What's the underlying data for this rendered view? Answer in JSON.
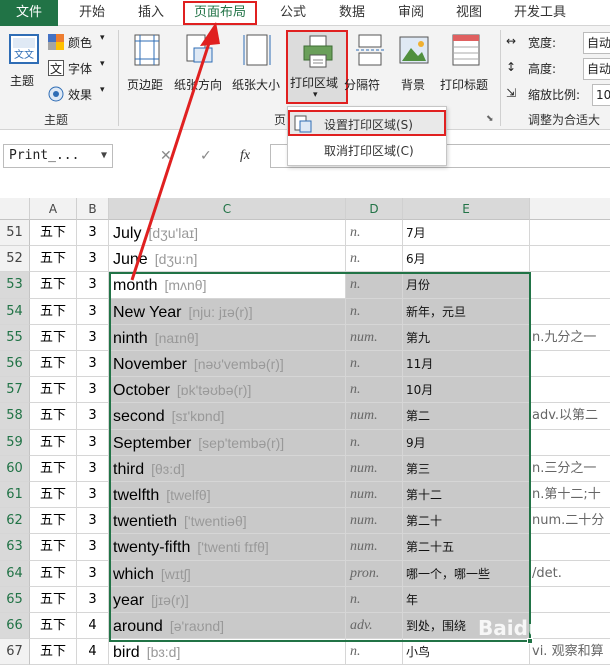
{
  "tabs": [
    {
      "label": "文件",
      "type": "file"
    },
    {
      "label": "开始"
    },
    {
      "label": "插入"
    },
    {
      "label": "页面布局",
      "active": true
    },
    {
      "label": "公式"
    },
    {
      "label": "数据"
    },
    {
      "label": "审阅"
    },
    {
      "label": "视图"
    },
    {
      "label": "开发工具"
    }
  ],
  "ribbon": {
    "theme_group": {
      "name": "主题",
      "theme_btn": "主题",
      "colors": "颜色",
      "fonts": "字体",
      "effects": "效果",
      "theme_icon_text": "文文"
    },
    "page_setup": {
      "margins": "页边距",
      "orientation": "纸张方向",
      "size": "纸张大小",
      "print_area": "打印区域",
      "breaks": "分隔符",
      "background": "背景",
      "print_titles": "打印标题",
      "group_name": "页"
    },
    "scale_group": {
      "width_label": "宽度:",
      "width_value": "自动",
      "height_label": "高度:",
      "height_value": "自动",
      "scale_label": "缩放比例:",
      "scale_value": "10",
      "group_name": "调整为合适大小"
    }
  },
  "print_area_menu": {
    "set": "设置打印区域(S)",
    "clear": "取消打印区域(C)"
  },
  "formula_bar": {
    "name_box": "Print_...",
    "cancel": "✕",
    "enter": "✓",
    "fx": "fx",
    "content": ""
  },
  "columns": [
    "A",
    "B",
    "C",
    "D",
    "E"
  ],
  "rows": [
    {
      "num": "51",
      "a": "五下",
      "b": "3",
      "word": "July",
      "phon": "[dʒu'laɪ]",
      "pos": "n.",
      "cn": "7月",
      "extra": ""
    },
    {
      "num": "52",
      "a": "五下",
      "b": "3",
      "word": "June",
      "phon": "[dʒu:n]",
      "pos": "n.",
      "cn": "6月",
      "extra": ""
    },
    {
      "num": "53",
      "a": "五下",
      "b": "3",
      "word": "month",
      "phon": "[mʌnθ]",
      "pos": "n.",
      "cn": "月份",
      "extra": ""
    },
    {
      "num": "54",
      "a": "五下",
      "b": "3",
      "word": "New Year",
      "phon": "[nju: jɪə(r)]",
      "pos": "n.",
      "cn": "新年，元旦",
      "extra": ""
    },
    {
      "num": "55",
      "a": "五下",
      "b": "3",
      "word": "ninth",
      "phon": "[naɪnθ]",
      "pos": "num.",
      "cn": "第九",
      "extra": "n.九分之一"
    },
    {
      "num": "56",
      "a": "五下",
      "b": "3",
      "word": "November",
      "phon": "[nəʊ'vembə(r)]",
      "pos": "n.",
      "cn": "11月",
      "extra": ""
    },
    {
      "num": "57",
      "a": "五下",
      "b": "3",
      "word": "October",
      "phon": "[ɒk'təʊbə(r)]",
      "pos": "n.",
      "cn": "10月",
      "extra": ""
    },
    {
      "num": "58",
      "a": "五下",
      "b": "3",
      "word": "second",
      "phon": "[sɪ'kɒnd]",
      "pos": "num.",
      "cn": "第二",
      "extra": "adv.以第二"
    },
    {
      "num": "59",
      "a": "五下",
      "b": "3",
      "word": "September",
      "phon": "[sep'tembə(r)]",
      "pos": "n.",
      "cn": "9月",
      "extra": ""
    },
    {
      "num": "60",
      "a": "五下",
      "b": "3",
      "word": "third",
      "phon": "[θɜ:d]",
      "pos": "num.",
      "cn": "第三",
      "extra": "n.三分之一"
    },
    {
      "num": "61",
      "a": "五下",
      "b": "3",
      "word": "twelfth",
      "phon": "[twelfθ]",
      "pos": "num.",
      "cn": "第十二",
      "extra": "n.第十二;十"
    },
    {
      "num": "62",
      "a": "五下",
      "b": "3",
      "word": "twentieth",
      "phon": "['twentiəθ]",
      "pos": "num.",
      "cn": "第二十",
      "extra": "num.二十分"
    },
    {
      "num": "63",
      "a": "五下",
      "b": "3",
      "word": "twenty-fifth",
      "phon": "['twenti fɪfθ]",
      "pos": "num.",
      "cn": "第二十五",
      "extra": ""
    },
    {
      "num": "64",
      "a": "五下",
      "b": "3",
      "word": "which",
      "phon": "[wɪtʃ]",
      "pos": "pron.",
      "cn": "哪一个，哪一些",
      "extra": "/det."
    },
    {
      "num": "65",
      "a": "五下",
      "b": "3",
      "word": "year",
      "phon": "[jɪə(r)]",
      "pos": "n.",
      "cn": "年",
      "extra": ""
    },
    {
      "num": "66",
      "a": "五下",
      "b": "4",
      "word": "around",
      "phon": "[ə'raʊnd]",
      "pos": "adv.",
      "cn": "到处，围绕",
      "extra": ""
    },
    {
      "num": "67",
      "a": "五下",
      "b": "4",
      "word": "bird",
      "phon": "[bɜ:d]",
      "pos": "n.",
      "cn": "小鸟",
      "extra": "vi. 观察和算"
    }
  ],
  "selection": {
    "first_row": "53",
    "last_row": "66"
  },
  "colors": {
    "accent": "#217346",
    "highlight": "#e02020",
    "selection_fill": "#c9c9c9",
    "header_fill": "#f2f2f2"
  },
  "watermark": "Baidu"
}
